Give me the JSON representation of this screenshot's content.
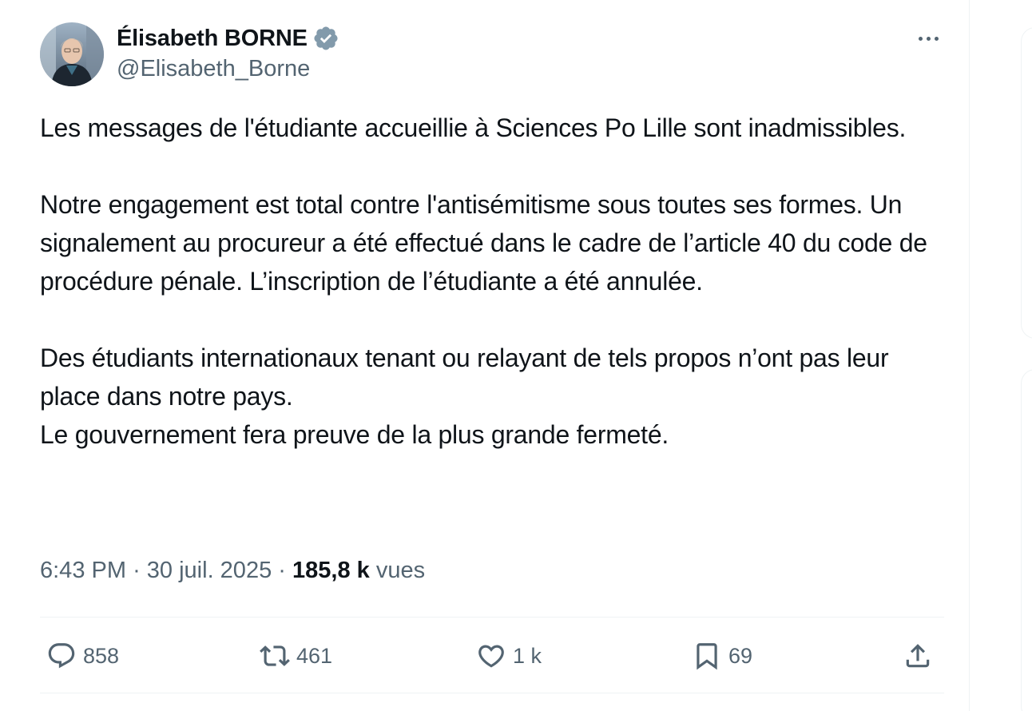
{
  "author": {
    "display_name": "Élisabeth BORNE",
    "handle": "@Elisabeth_Borne"
  },
  "tweet": {
    "paragraphs": [
      "Les messages de l'étudiante accueillie à Sciences Po Lille sont inadmissibles.",
      "Notre engagement est total contre l'antisémitisme sous toutes ses formes. Un signalement au procureur a été effectué dans le cadre de l’article 40 du code de procédure pénale. L’inscription de l’étudiante a été annulée.",
      "Des étudiants internationaux tenant ou relayant de tels propos n’ont pas leur place dans notre pays.",
      "Le gouvernement fera preuve de la plus grande fermeté."
    ]
  },
  "meta": {
    "time": "6:43 PM",
    "separator": "·",
    "date": "30 juil. 2025",
    "views_count": "185,8 k",
    "views_label": "vues"
  },
  "actions": {
    "replies": "858",
    "reposts": "461",
    "likes": "1 k",
    "bookmarks": "69"
  },
  "icons": {
    "verified": "verified-badge-icon",
    "more": "more-icon",
    "reply": "reply-icon",
    "repost": "repost-icon",
    "like": "heart-icon",
    "bookmark": "bookmark-icon",
    "share": "share-icon"
  },
  "colors": {
    "text": "#0f1419",
    "secondary": "#536471",
    "verified": "#829aab",
    "border": "#eff3f4"
  }
}
